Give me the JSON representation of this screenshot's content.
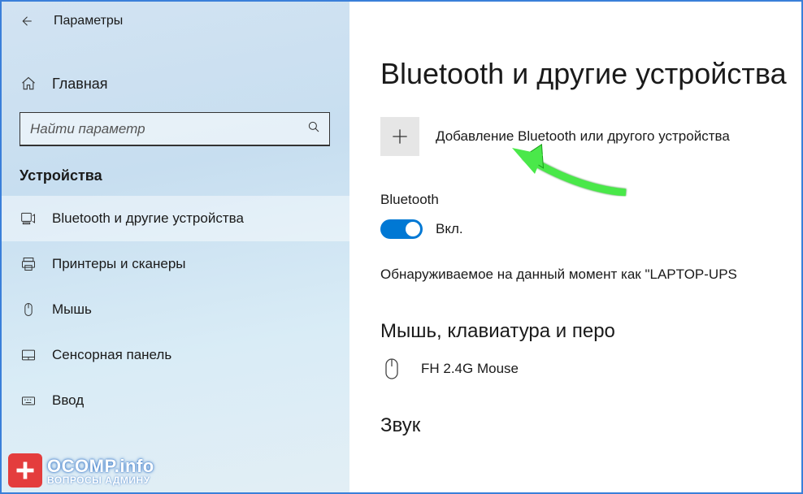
{
  "titlebar": {
    "app_title": "Параметры"
  },
  "sidebar": {
    "home_label": "Главная",
    "search_placeholder": "Найти параметр",
    "section_title": "Устройства",
    "items": [
      {
        "label": "Bluetooth и другие устройства"
      },
      {
        "label": "Принтеры и сканеры"
      },
      {
        "label": "Мышь"
      },
      {
        "label": "Сенсорная панель"
      },
      {
        "label": "Ввод"
      }
    ]
  },
  "main": {
    "page_title": "Bluetooth и другие устройства",
    "add_label": "Добавление Bluetooth или другого устройства",
    "bt_heading": "Bluetooth",
    "toggle_state": "Вкл.",
    "discoverable_text": "Обнаруживаемое на данный момент как \"LAPTOP-UPS",
    "section_mouse_kbd": "Мышь, клавиатура и перо",
    "device_name": "FH 2.4G Mouse",
    "section_sound": "Звук"
  },
  "watermark": {
    "top": "OCOMP.info",
    "bottom": "ВОПРОСЫ АДМИНУ"
  },
  "colors": {
    "accent": "#0078d4",
    "arrow": "#4ae84a"
  }
}
